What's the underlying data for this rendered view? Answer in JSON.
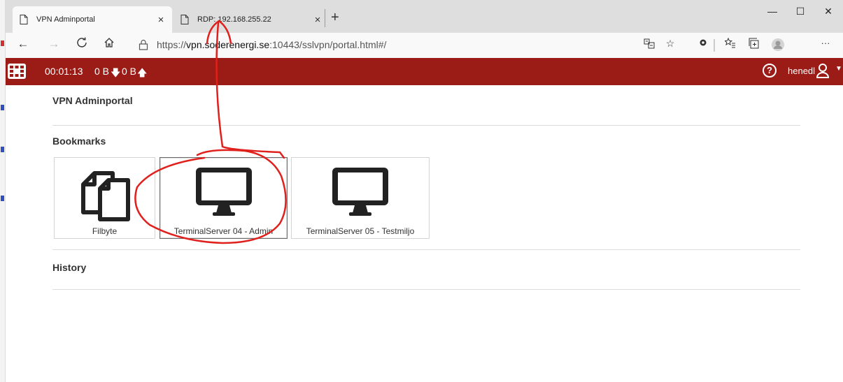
{
  "browser": {
    "tabs": [
      {
        "label": "VPN Adminportal",
        "active": true,
        "close": "×"
      },
      {
        "label": "RDP: 192.168.255.22",
        "active": false,
        "close": "×"
      }
    ],
    "new_tab": "+",
    "window_controls": {
      "minimize": "—",
      "maximize": "☐",
      "close": "✕"
    },
    "address": {
      "prefix": "https://",
      "domain": "vpn.soderenergi.se",
      "rest": ":10443/sslvpn/portal.html#/"
    }
  },
  "vpn_bar": {
    "timer": "00:01:13",
    "download": "0 B",
    "upload": "0 B",
    "help": "?",
    "username": "henedl"
  },
  "page": {
    "title": "VPN Adminportal",
    "bookmarks_heading": "Bookmarks",
    "bookmarks": [
      {
        "label": "Filbyte",
        "icon": "files-icon"
      },
      {
        "label": "TerminalServer 04 - Admin",
        "icon": "monitor-icon"
      },
      {
        "label": "TerminalServer 05 - Testmiljo",
        "icon": "monitor-icon"
      }
    ],
    "history_heading": "History"
  },
  "colors": {
    "vpn_bar": "#9b1b16",
    "annotation": "#e0201c",
    "tab_bar": "#dedede"
  }
}
